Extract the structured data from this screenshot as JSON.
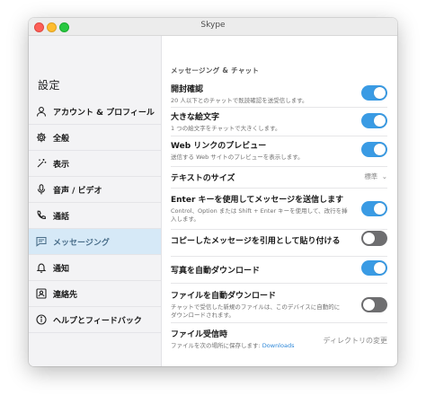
{
  "window": {
    "title": "Skype"
  },
  "sidebar": {
    "heading": "設定",
    "items": [
      {
        "label": "アカウント & プロフィール",
        "icon": "person-icon"
      },
      {
        "label": "全般",
        "icon": "gear-icon"
      },
      {
        "label": "表示",
        "icon": "magic-wand-icon"
      },
      {
        "label": "音声 / ビデオ",
        "icon": "microphone-icon"
      },
      {
        "label": "通話",
        "icon": "phone-icon"
      },
      {
        "label": "メッセージング",
        "icon": "chat-icon",
        "active": true
      },
      {
        "label": "通知",
        "icon": "bell-icon"
      },
      {
        "label": "連絡先",
        "icon": "contact-card-icon"
      },
      {
        "label": "ヘルプとフィードバック",
        "icon": "info-icon"
      }
    ]
  },
  "main": {
    "section_title": "メッセージング & チャット",
    "settings": [
      {
        "title": "開封確認",
        "desc": "20 人以下とのチャットで既読確認を送受信します。",
        "toggle": true
      },
      {
        "title": "大きな絵文字",
        "desc": "1 つの絵文字をチャットで大きくします。",
        "toggle": true
      },
      {
        "title": "Web リンクのプレビュー",
        "desc": "送信する Web サイトのプレビューを表示します。",
        "toggle": true
      },
      {
        "title": "テキストのサイズ",
        "value": "標準"
      },
      {
        "title": "Enter キーを使用してメッセージを送信します",
        "desc_line1": "Control、Option または Shift + Enter キーを使用して、改行を挿",
        "desc_line2": "入します。",
        "toggle": true
      },
      {
        "title": "コピーしたメッセージを引用として貼り付ける",
        "toggle": false
      },
      {
        "title": "写真を自動ダウンロード",
        "toggle": true
      },
      {
        "title": "ファイルを自動ダウンロード",
        "desc_line1": "チャットで受信した新規のファイルは、このデバイスに自動的に",
        "desc_line2": "ダウンロードされます。",
        "toggle": false
      },
      {
        "title": "ファイル受信時",
        "desc_prefix": "ファイルを次の場所に保存します: ",
        "link": "Downloads",
        "action": "ディレクトリの変更"
      }
    ]
  },
  "colors": {
    "toggle_on": "#3a9be4",
    "toggle_off": "#6e6e70",
    "active_nav": "#d6e9f7",
    "link": "#2b86d8"
  }
}
